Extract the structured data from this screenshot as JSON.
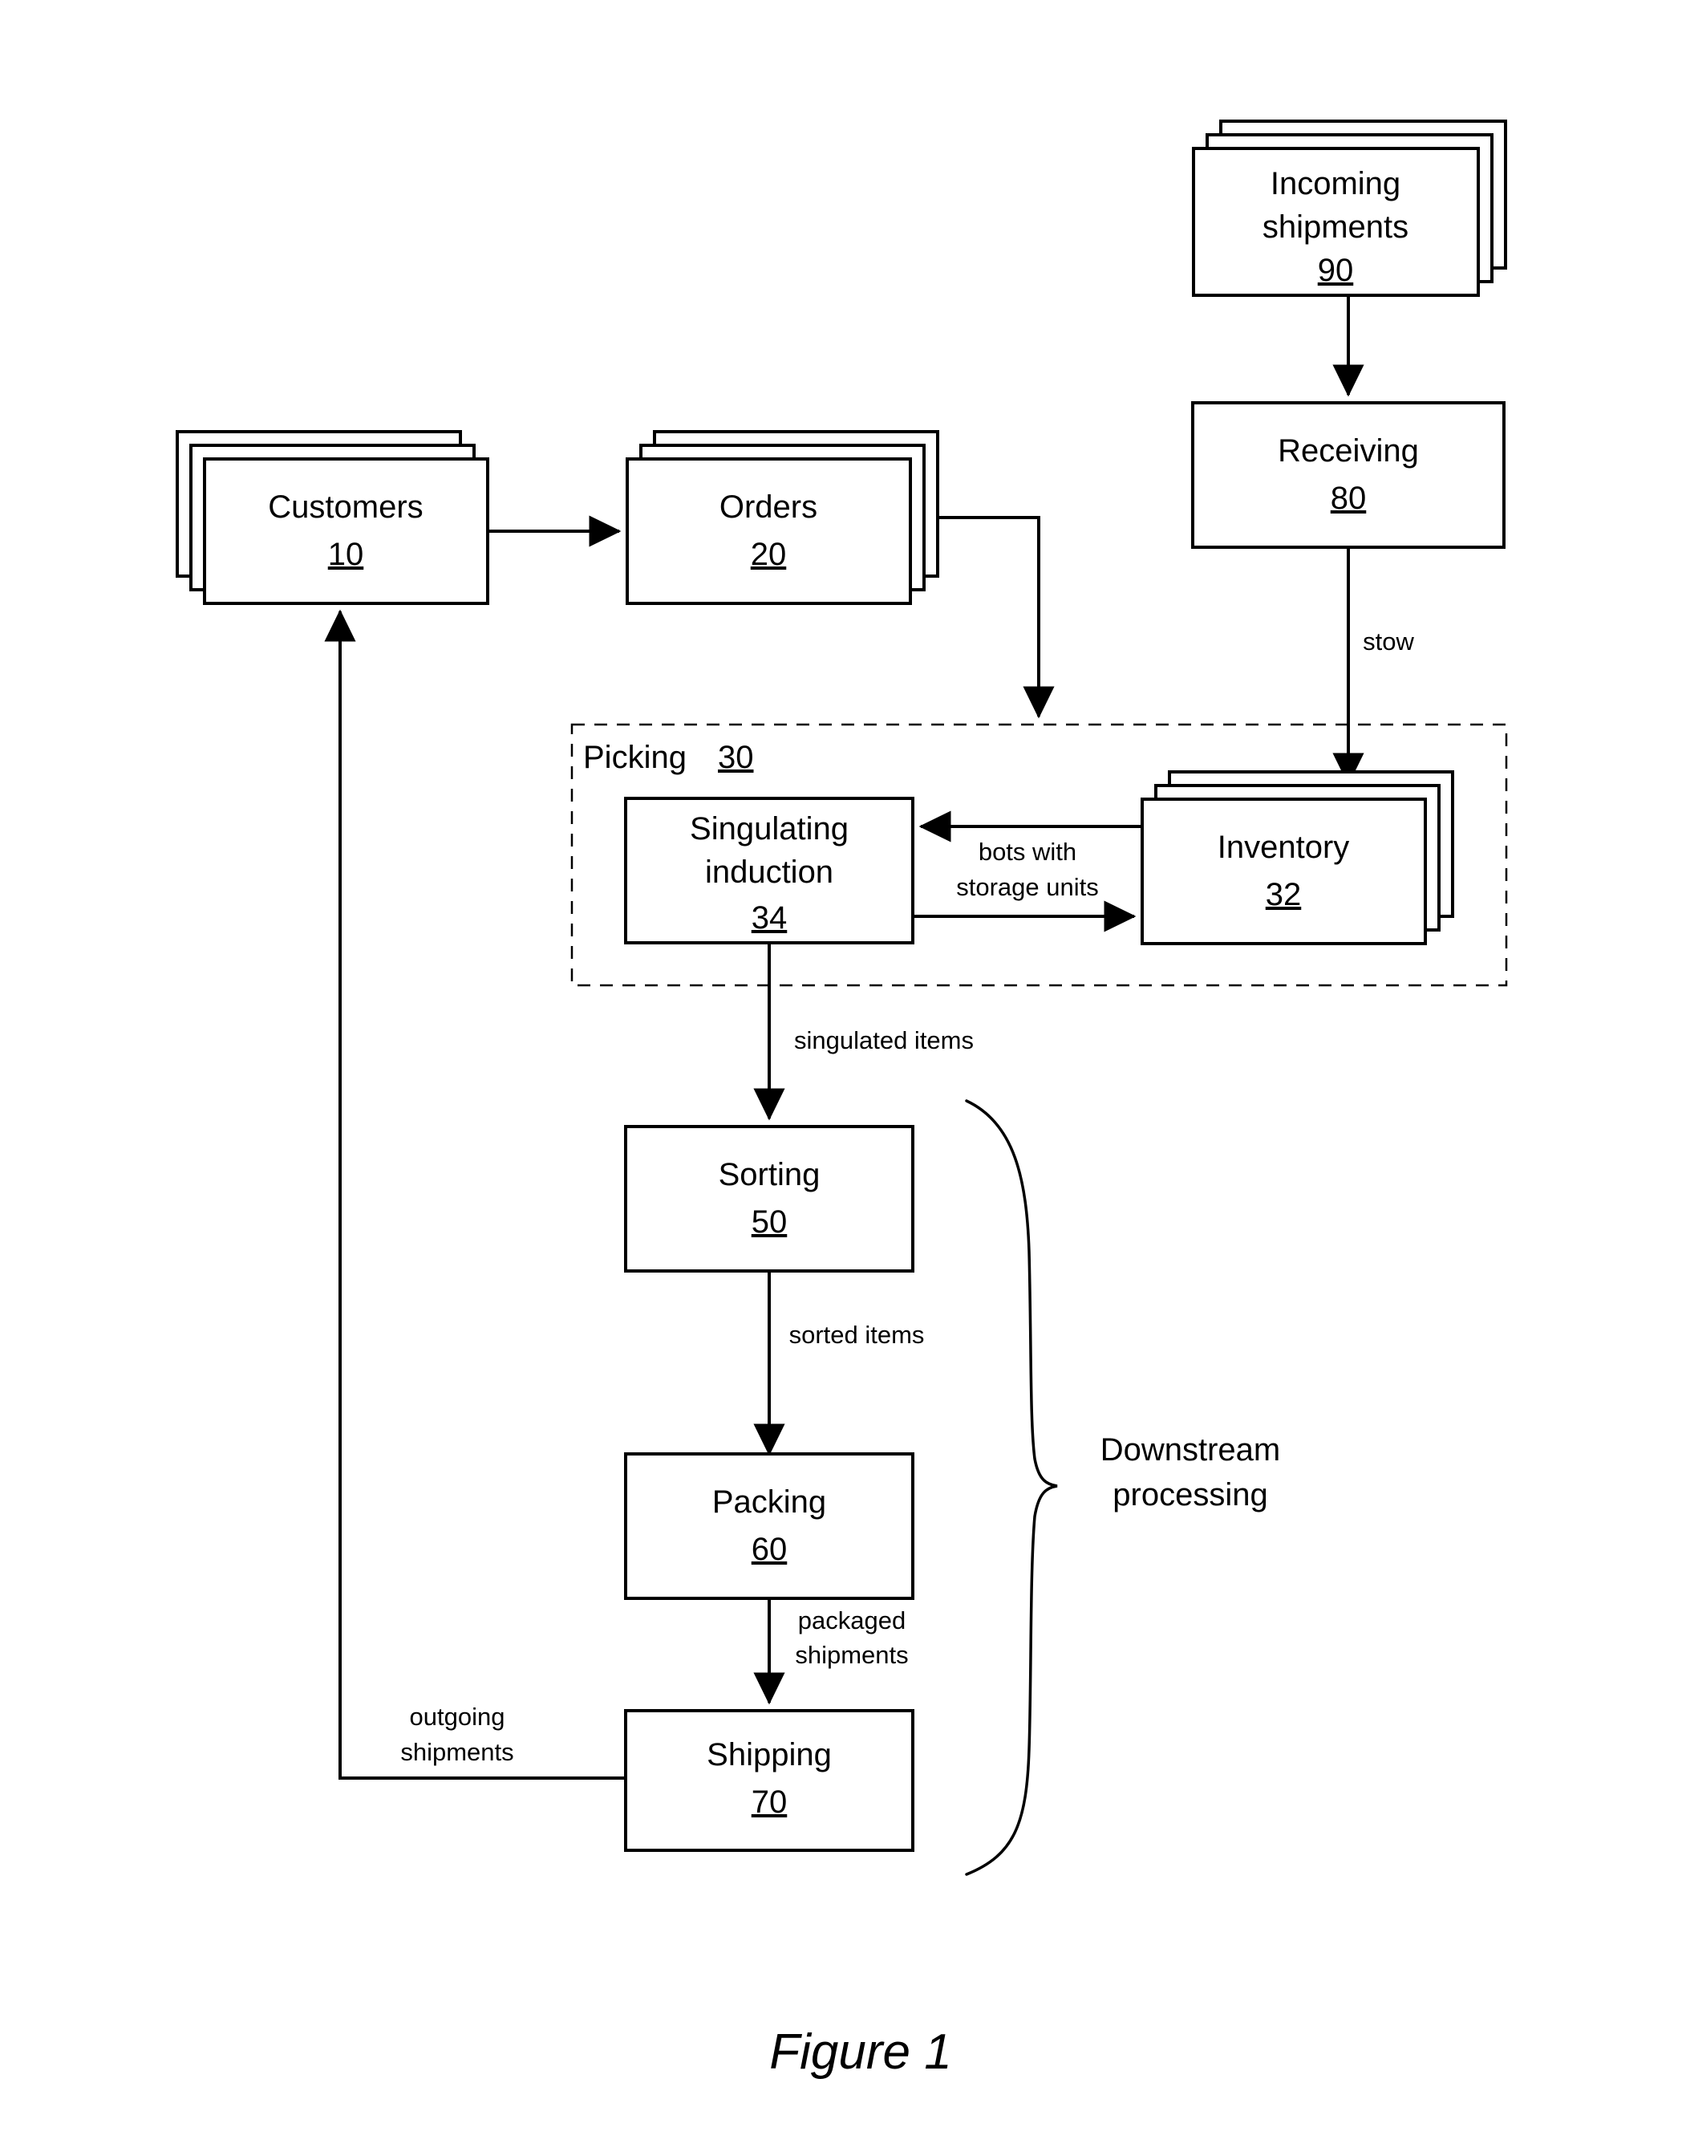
{
  "figure": {
    "caption": "Figure 1"
  },
  "nodes": {
    "customers": {
      "label": "Customers",
      "ref": "10",
      "stacked": true
    },
    "orders": {
      "label": "Orders",
      "ref": "20",
      "stacked": true
    },
    "picking": {
      "label": "Picking",
      "ref": "30"
    },
    "inventory": {
      "label": "Inventory",
      "ref": "32",
      "stacked": true
    },
    "singulating": {
      "label_line1": "Singulating",
      "label_line2": "induction",
      "ref": "34"
    },
    "sorting": {
      "label": "Sorting",
      "ref": "50"
    },
    "packing": {
      "label": "Packing",
      "ref": "60"
    },
    "shipping": {
      "label": "Shipping",
      "ref": "70"
    },
    "receiving": {
      "label": "Receiving",
      "ref": "80"
    },
    "incoming": {
      "label_line1": "Incoming",
      "label_line2": "shipments",
      "ref": "90",
      "stacked": true
    }
  },
  "edges": {
    "incoming_to_receiving": {
      "label": ""
    },
    "customers_to_orders": {
      "label": ""
    },
    "orders_to_picking": {
      "label": ""
    },
    "receiving_to_inventory": {
      "label": "stow"
    },
    "inventory_to_singulating": {
      "label_line1": "bots with",
      "label_line2": "storage units"
    },
    "singulating_to_inventory": {
      "label": ""
    },
    "singulating_to_sorting": {
      "label": "singulated items"
    },
    "sorting_to_packing": {
      "label": "sorted items"
    },
    "packing_to_shipping": {
      "label_line1": "packaged",
      "label_line2": "shipments"
    },
    "shipping_to_customers": {
      "label_line1": "outgoing",
      "label_line2": "shipments"
    }
  },
  "annotations": {
    "downstream": {
      "label_line1": "Downstream",
      "label_line2": "processing"
    }
  },
  "colors": {
    "stroke": "#000000",
    "background": "#ffffff"
  }
}
